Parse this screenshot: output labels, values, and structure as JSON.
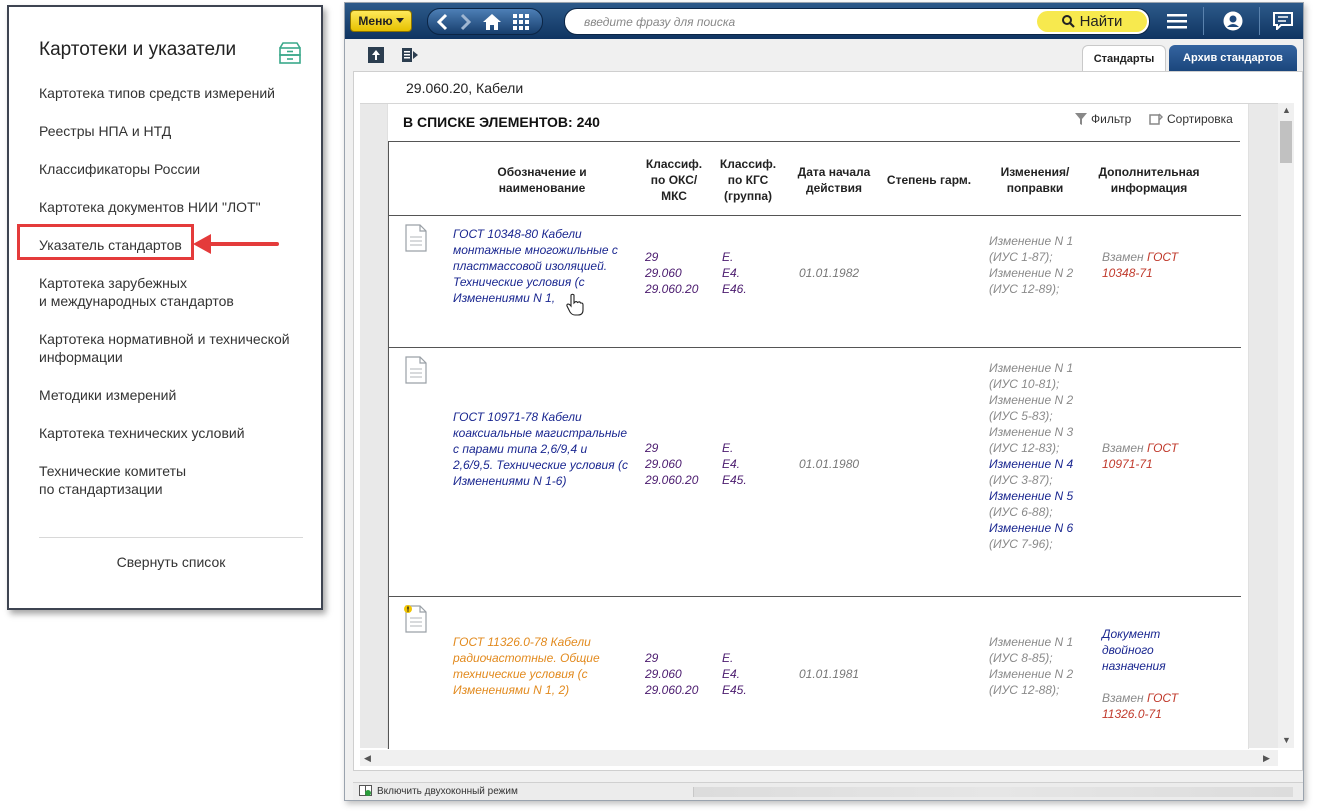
{
  "left_panel": {
    "title": "Картотеки и указатели",
    "items": [
      "Картотека типов средств измерений",
      "Реестры НПА и НТД",
      "Классификаторы России",
      "Картотека документов НИИ \"ЛОТ\"",
      "Указатель стандартов",
      "Картотека зарубежных\nи международных стандартов",
      "Картотека нормативной и технической\nинформации",
      "Методики измерений",
      "Картотека технических условий",
      "Технические комитеты\nпо стандартизации"
    ],
    "collapse": "Свернуть список",
    "highlighted_item": "Указатель стандартов",
    "highlight_color": "#e43b3b"
  },
  "top_bar": {
    "menu_label": "Меню",
    "search_placeholder": "введите фразу для поиска",
    "find_label": "Найти",
    "icons": [
      "back-icon",
      "forward-icon",
      "home-icon",
      "grid-icon",
      "hamburger-icon",
      "user-icon",
      "feedback-icon"
    ]
  },
  "tabs": {
    "standards": "Стандарты",
    "archive": "Архив стандартов"
  },
  "breadcrumb": "29.060.20, Кабели",
  "list": {
    "count_label": "В СПИСКЕ ЭЛЕМЕНТОВ: 240",
    "filter": "Фильтр",
    "sort": "Сортировка",
    "headers": {
      "title": "Обозначение и\nнаименование",
      "oks": "Классиф.\nпо ОКС/\nМКС",
      "kgs": "Классиф.\nпо КГС\n(группа)",
      "date": "Дата начала\nдействия",
      "harm": "Степень гарм.",
      "changes": "Изменения/\nпоправки",
      "extra": "Дополнительная\nинформация"
    },
    "rows": [
      {
        "title": "ГОСТ 10348-80 Кабели монтажные многожильные с пластмассовой изоляцией. Технические условия (с Изменениями N 1,",
        "oks": "29\n29.060\n29.060.20",
        "kgs": "Е.\nЕ4.\nЕ46.",
        "date": "01.01.1982",
        "changes": "Изменение N 1\n(ИУС 1-87);\nИзменение N 2\n(ИУС 12-89);",
        "extra_prefix": "Взамен ",
        "extra_link": "ГОСТ\n10348-71"
      },
      {
        "title": "ГОСТ 10971-78 Кабели коаксиальные магистральные с парами типа 2,6/9,4 и 2,6/9,5. Технические условия (с Изменениями N 1-6)",
        "oks": "29\n29.060\n29.060.20",
        "kgs": "Е.\nЕ4.\nЕ45.",
        "date": "01.01.1980",
        "changes_grey": "Изменение N 1\n(ИУС 10-81);\nИзменение N 2\n(ИУС 5-83);\nИзменение N 3\n(ИУС 12-83);",
        "changes_blue_1": "Изменение N 4",
        "changes_grey_2": "(ИУС 3-87);",
        "changes_blue_2": "Изменение N 5",
        "changes_grey_3": "(ИУС 6-88);",
        "changes_blue_3": "Изменение N 6",
        "changes_grey_4": "(ИУС 7-96);",
        "extra_prefix": "Взамен ",
        "extra_link": "ГОСТ\n10971-71"
      },
      {
        "title": "ГОСТ 11326.0-78 Кабели радиочастотные. Общие технические условия (с Изменениями N 1, 2)",
        "oks": "29\n29.060\n29.060.20",
        "kgs": "Е.\nЕ4.\nЕ45.",
        "date": "01.01.1981",
        "changes": "Изменение N 1\n(ИУС 8-85);\nИзменение N 2\n(ИУС 12-88);",
        "extra_note": "Документ\nдвойного\nназначения",
        "extra_prefix": "Взамен ",
        "extra_link": "ГОСТ\n11326.0-71"
      }
    ]
  },
  "status_bar": {
    "two_window": "Включить двухоконный режим"
  }
}
